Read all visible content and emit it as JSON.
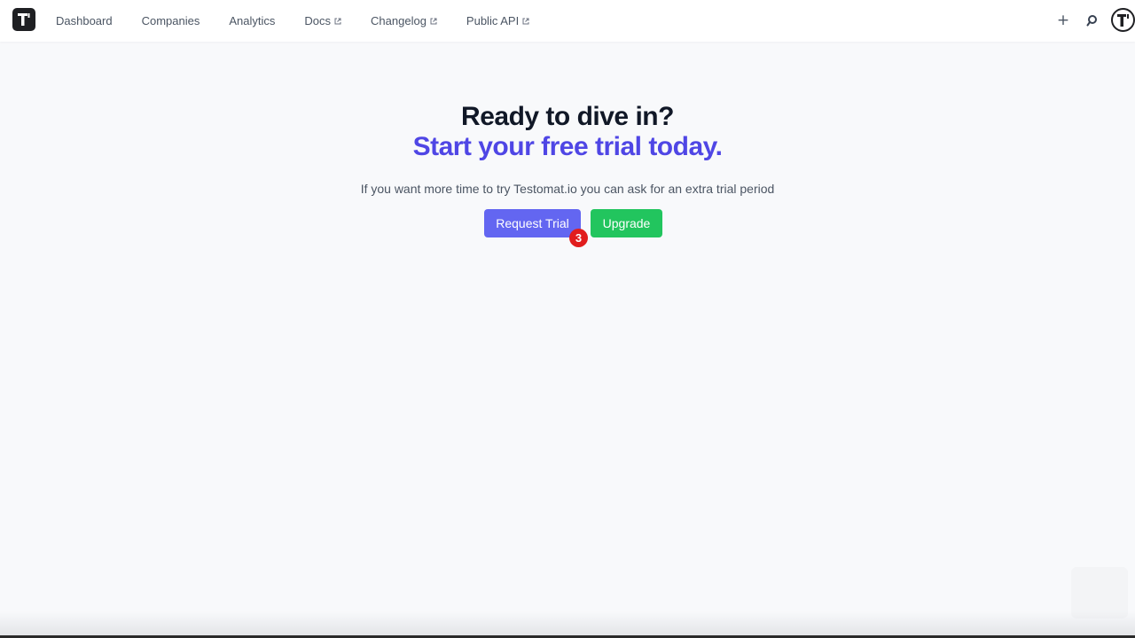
{
  "nav": {
    "items": [
      {
        "label": "Dashboard",
        "external": false
      },
      {
        "label": "Companies",
        "external": false
      },
      {
        "label": "Analytics",
        "external": false
      },
      {
        "label": "Docs",
        "external": true
      },
      {
        "label": "Changelog",
        "external": true
      },
      {
        "label": "Public API",
        "external": true
      }
    ],
    "add_icon": "plus-icon",
    "search_icon": "search-icon",
    "avatar_icon": "testomat-logo-icon"
  },
  "hero": {
    "title": "Ready to dive in?",
    "subtitle": "Start your free trial today.",
    "description": "If you want more time to try Testomat.io you can ask for an extra trial period"
  },
  "actions": {
    "request_trial_label": "Request Trial",
    "upgrade_label": "Upgrade",
    "badge_count": "3"
  },
  "colors": {
    "accent": "#4f46e5",
    "primary_button": "#6366f1",
    "upgrade_button": "#22c55e",
    "badge": "#e11d1d"
  }
}
